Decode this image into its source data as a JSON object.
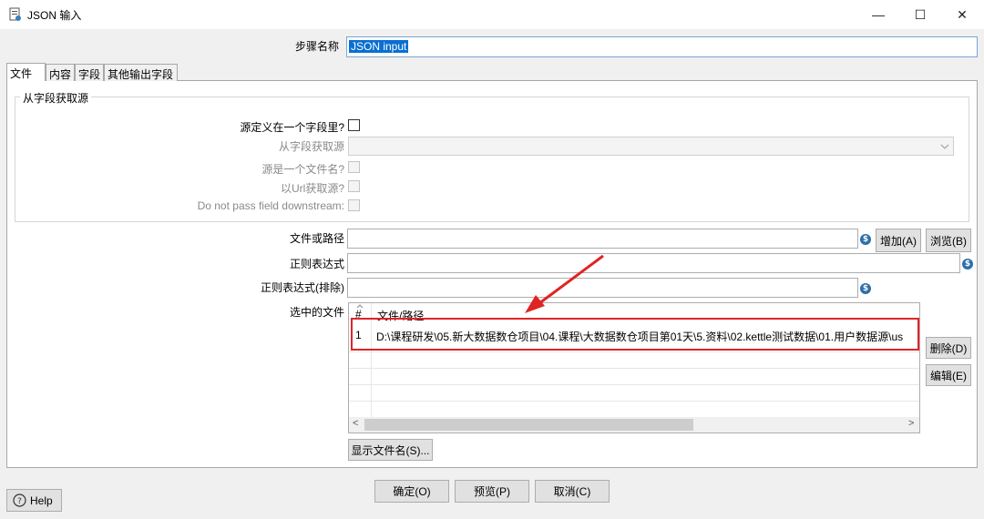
{
  "window": {
    "title": "JSON 输入",
    "minimize": "—",
    "maximize": "☐",
    "close": "✕"
  },
  "step": {
    "label": "步骤名称",
    "value": "JSON input"
  },
  "tabs": [
    "文件",
    "内容",
    "字段",
    "其他输出字段"
  ],
  "group": {
    "title": "从字段获取源",
    "source_in_field_label": "源定义在一个字段里?",
    "get_source_from_field_label": "从字段获取源",
    "source_is_filename_label": "源是一个文件名?",
    "read_source_as_url_label": "以Url获取源?",
    "do_not_pass_label": "Do not pass field downstream:"
  },
  "file": {
    "file_or_dir_label": "文件或路径",
    "regex_label": "正则表达式",
    "regex_exclude_label": "正则表达式(排除)",
    "add_button": "增加(A)",
    "browse_button": "浏览(B)",
    "variable_icon": "$"
  },
  "selected_files": {
    "label": "选中的文件",
    "columns": [
      "#",
      "文件/路径"
    ],
    "rows": [
      {
        "num": "1",
        "path": "D:\\课程研发\\05.新大数据数仓项目\\04.课程\\大数据数仓项目第01天\\5.资料\\02.kettle测试数据\\01.用户数据源\\us"
      }
    ],
    "delete_button": "删除(D)",
    "edit_button": "编辑(E)",
    "show_filenames_button": "显示文件名(S)...",
    "scroll_left": "<",
    "scroll_right": ">"
  },
  "footer": {
    "ok": "确定(O)",
    "preview": "预览(P)",
    "cancel": "取消(C)",
    "help": "Help"
  }
}
